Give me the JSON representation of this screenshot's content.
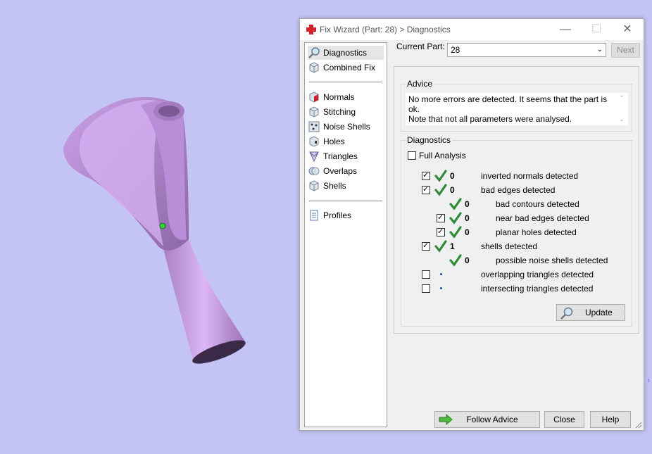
{
  "window": {
    "title": "Fix Wizard (Part: 28) > Diagnostics",
    "minimize_icon": "minimize-icon",
    "maximize_icon": "maximize-icon",
    "close_icon": "close-icon"
  },
  "nav": {
    "group1": [
      {
        "label": "Diagnostics",
        "icon": "magnifier-icon",
        "selected": true
      },
      {
        "label": "Combined Fix",
        "icon": "cube-icon"
      }
    ],
    "group2": [
      {
        "label": "Normals",
        "icon": "normals-cube-icon"
      },
      {
        "label": "Stitching",
        "icon": "stitching-cube-icon"
      },
      {
        "label": "Noise Shells",
        "icon": "noise-shells-icon"
      },
      {
        "label": "Holes",
        "icon": "holes-cube-icon"
      },
      {
        "label": "Triangles",
        "icon": "triangles-icon"
      },
      {
        "label": "Overlaps",
        "icon": "overlaps-icon"
      },
      {
        "label": "Shells",
        "icon": "shells-icon"
      }
    ],
    "group3": [
      {
        "label": "Profiles",
        "icon": "profiles-document-icon"
      }
    ]
  },
  "current_part": {
    "label": "Current Part:",
    "value": "28"
  },
  "next_label": "Next",
  "advice": {
    "title": "Advice",
    "line1": "No more errors are detected. It seems that the part is ok.",
    "line2": "Note that not all parameters were analysed."
  },
  "diagnostics": {
    "title": "Diagnostics",
    "full_analysis_label": "Full Analysis",
    "rows": [
      {
        "checkbox": true,
        "checked": true,
        "status": "ok",
        "count": "0",
        "label": "inverted normals detected",
        "indent": 0
      },
      {
        "checkbox": true,
        "checked": true,
        "status": "ok",
        "count": "0",
        "label": "bad edges detected",
        "indent": 0
      },
      {
        "checkbox": false,
        "checked": false,
        "status": "ok",
        "count": "0",
        "label": "bad contours detected",
        "indent": 1
      },
      {
        "checkbox": true,
        "checked": true,
        "status": "ok",
        "count": "0",
        "label": "near bad edges detected",
        "indent": 1
      },
      {
        "checkbox": true,
        "checked": true,
        "status": "ok",
        "count": "0",
        "label": "planar holes detected",
        "indent": 1
      },
      {
        "checkbox": true,
        "checked": true,
        "status": "ok",
        "count": "1",
        "label": "shells detected",
        "indent": 0
      },
      {
        "checkbox": false,
        "checked": false,
        "status": "ok",
        "count": "0",
        "label": "possible noise shells detected",
        "indent": 1
      },
      {
        "checkbox": true,
        "checked": false,
        "status": "pending",
        "count": "",
        "label": "overlapping triangles detected",
        "indent": 0
      },
      {
        "checkbox": true,
        "checked": false,
        "status": "pending",
        "count": "",
        "label": "intersecting triangles detected",
        "indent": 0
      }
    ],
    "update_label": "Update"
  },
  "buttons": {
    "follow_advice": "Follow Advice",
    "close": "Close",
    "help": "Help"
  },
  "colors": {
    "background": "#c4c4f4",
    "model": "#c79ae6",
    "check_green": "#2e8b3a",
    "dialog": "#f0f0f0"
  }
}
